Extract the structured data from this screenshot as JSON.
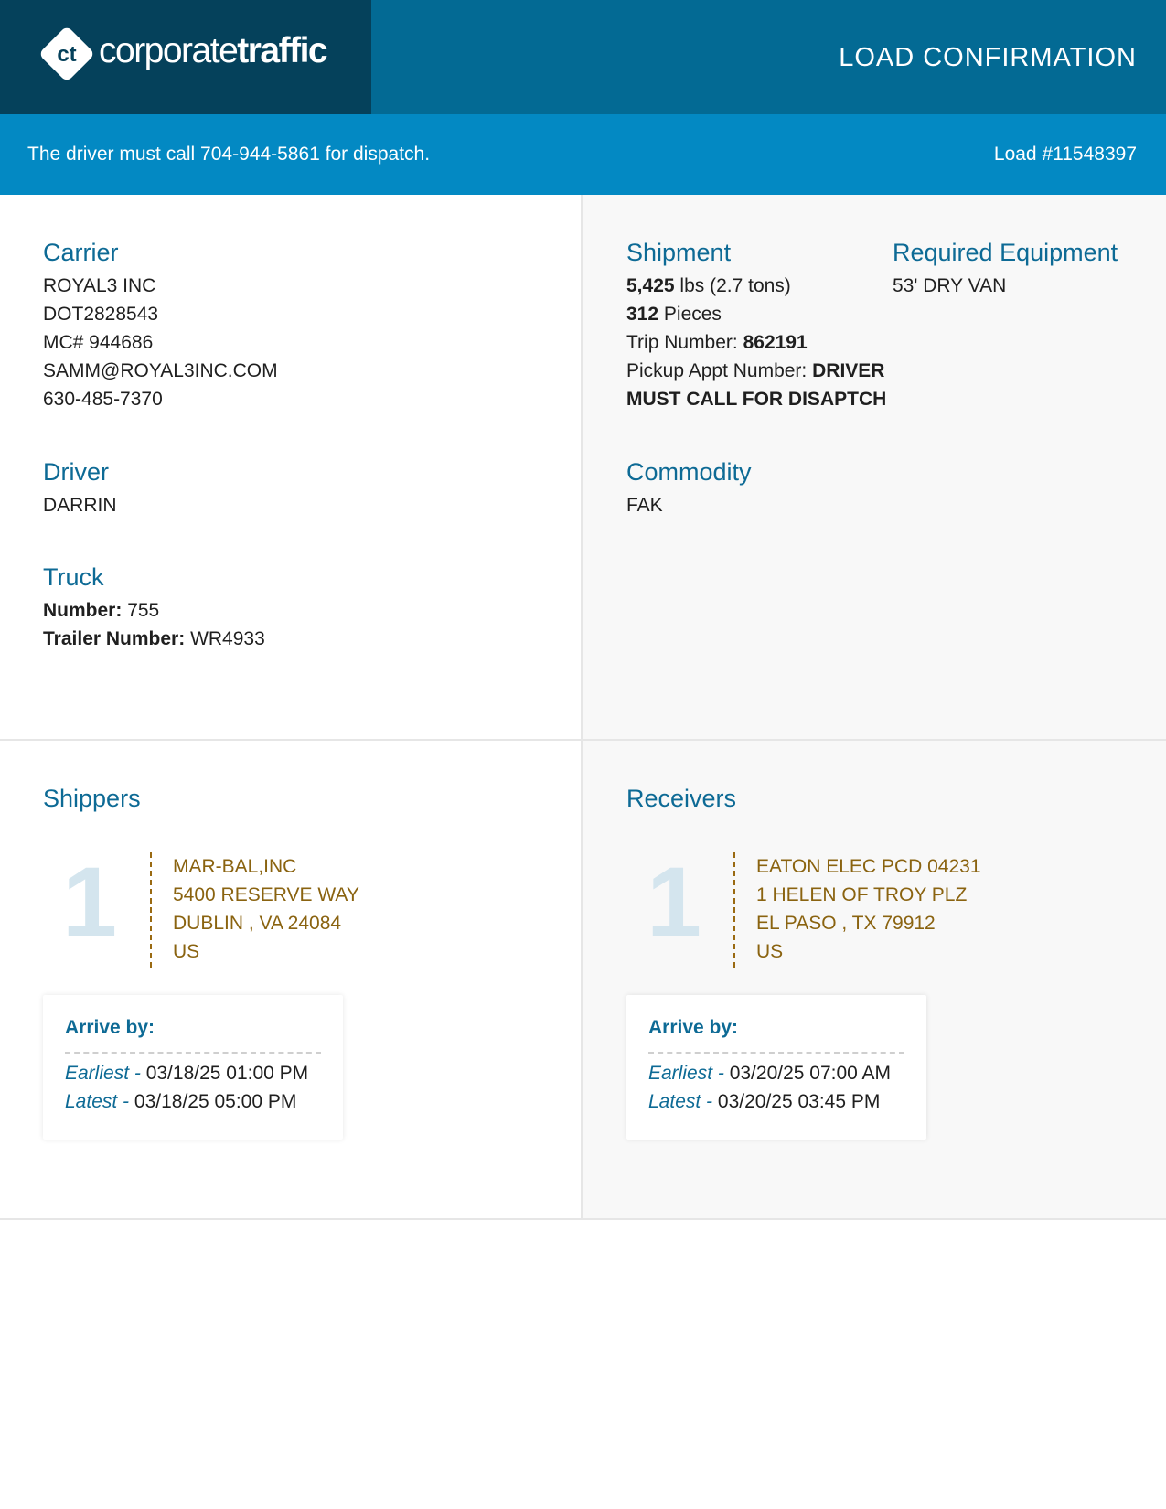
{
  "header": {
    "logo_initials": "ct",
    "logo_word_light": "corporate",
    "logo_word_bold": "traffic",
    "title": "LOAD CONFIRMATION"
  },
  "banner": {
    "message": "The driver must call 704-944-5861 for dispatch.",
    "load_number": "Load #11548397"
  },
  "carrier": {
    "title": "Carrier",
    "name": "ROYAL3 INC",
    "dot": "DOT2828543",
    "mc": "MC# 944686",
    "email": "SAMM@ROYAL3INC.COM",
    "phone": "630-485-7370"
  },
  "driver": {
    "title": "Driver",
    "name": "DARRIN"
  },
  "truck": {
    "title": "Truck",
    "number_label": "Number:",
    "number": "755",
    "trailer_label": "Trailer Number:",
    "trailer": "WR4933"
  },
  "shipment": {
    "title": "Shipment",
    "weight": "5,425",
    "weight_unit": "lbs (2.7 tons)",
    "pieces": "312",
    "pieces_unit": "Pieces",
    "trip_label": "Trip Number:",
    "trip": "862191",
    "pickup_label": "Pickup Appt Number:",
    "pickup_line1": "DRIVER",
    "pickup_line2": "MUST CALL FOR DISAPTCH"
  },
  "equipment": {
    "title": "Required Equipment",
    "value": "53' DRY VAN"
  },
  "commodity": {
    "title": "Commodity",
    "value": "FAK"
  },
  "shippers": {
    "title": "Shippers",
    "stop_number": "1",
    "name": "MAR-BAL,INC",
    "street": "5400 RESERVE WAY",
    "city": "DUBLIN , VA 24084",
    "country": "US",
    "arrive_label": "Arrive by:",
    "earliest_label": "Earliest -",
    "earliest": "03/18/25 01:00 PM",
    "latest_label": "Latest -",
    "latest": "03/18/25 05:00 PM"
  },
  "receivers": {
    "title": "Receivers",
    "stop_number": "1",
    "name": "EATON ELEC PCD 04231",
    "street": "1 HELEN OF TROY PLZ",
    "city": "EL PASO , TX 79912",
    "country": "US",
    "arrive_label": "Arrive by:",
    "earliest_label": "Earliest -",
    "earliest": "03/20/25 07:00 AM",
    "latest_label": "Latest -",
    "latest": "03/20/25 03:45 PM"
  }
}
